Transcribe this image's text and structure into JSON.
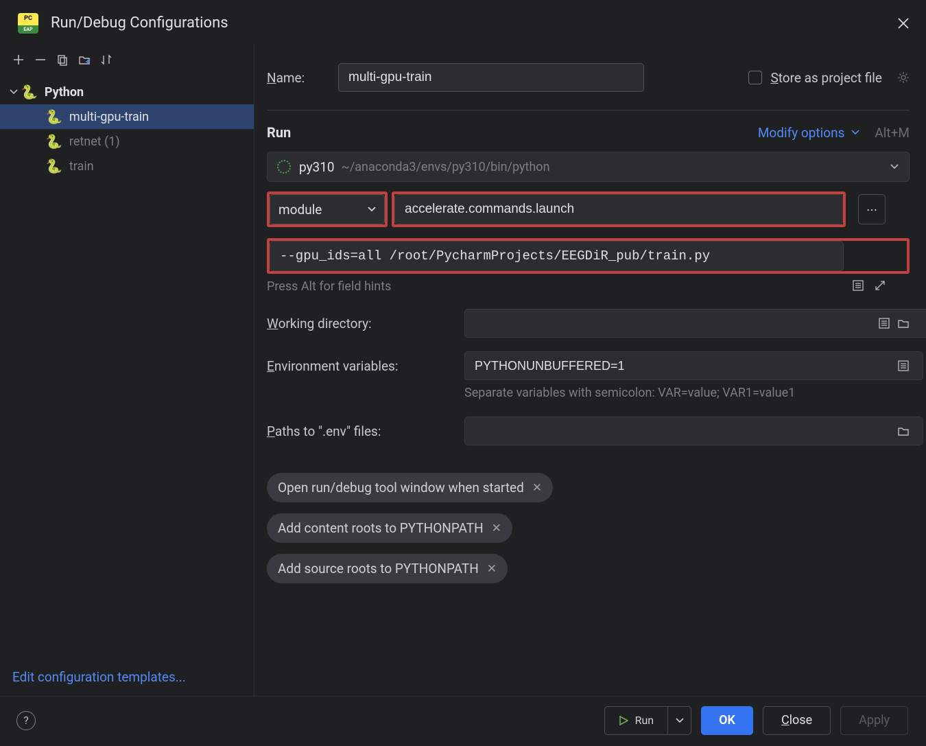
{
  "title": "Run/Debug Configurations",
  "tree": {
    "parent": "Python",
    "items": [
      {
        "label": "multi-gpu-train",
        "selected": true
      },
      {
        "label": "retnet (1)",
        "selected": false,
        "dim": true
      },
      {
        "label": "train",
        "selected": false,
        "dim": true
      }
    ]
  },
  "edit_templates": "Edit configuration templates...",
  "form": {
    "name_label": "Name:",
    "name_value": "multi-gpu-train",
    "store_label": "Store as project file",
    "run_title": "Run",
    "modify_label": "Modify options",
    "modify_shortcut": "Alt+M",
    "interpreter_name": "py310",
    "interpreter_path": "~/anaconda3/envs/py310/bin/python",
    "module_select": "module",
    "module_name": "accelerate.commands.launch",
    "params": "--gpu_ids=all /root/PycharmProjects/EEGDiR_pub/train.py",
    "hint": "Press Alt for field hints",
    "wd_label": "Working directory:",
    "wd_value": "",
    "env_label": "Environment variables:",
    "env_value": "PYTHONUNBUFFERED=1",
    "env_helper": "Separate variables with semicolon: VAR=value; VAR1=value1",
    "paths_label": "Paths to \".env\" files:",
    "paths_value": "",
    "chips": [
      "Open run/debug tool window when started",
      "Add content roots to PYTHONPATH",
      "Add source roots to PYTHONPATH"
    ]
  },
  "footer": {
    "run": "Run",
    "ok": "OK",
    "close": "Close",
    "apply": "Apply"
  }
}
